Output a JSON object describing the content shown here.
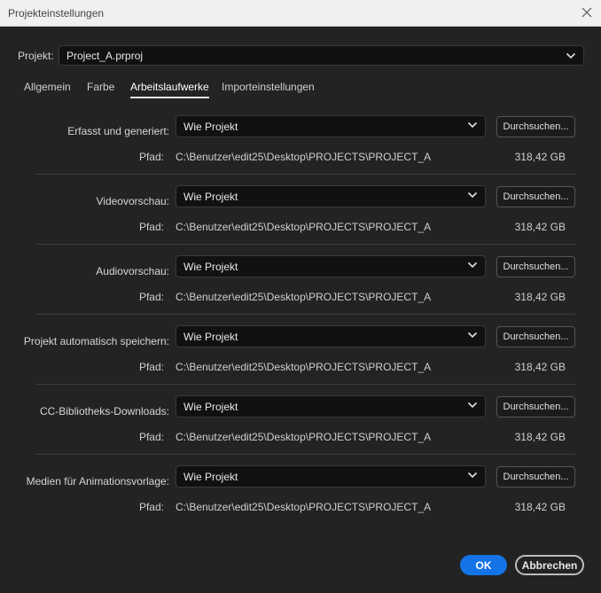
{
  "window": {
    "title": "Projekteinstellungen"
  },
  "project": {
    "label": "Projekt:",
    "value": "Project_A.prproj"
  },
  "tabs": [
    {
      "label": "Allgemein"
    },
    {
      "label": "Farbe"
    },
    {
      "label": "Arbeitslaufwerke",
      "active": true
    },
    {
      "label": "Importeinstellungen"
    }
  ],
  "sections": [
    {
      "label": "Erfasst und generiert:",
      "value": "Wie Projekt",
      "browse": "Durchsuchen...",
      "path_label": "Pfad:",
      "path": "C:\\Benutzer\\edit25\\Desktop\\PROJECTS\\PROJECT_A",
      "size": "318,42 GB"
    },
    {
      "label": "Videovorschau:",
      "value": "Wie Projekt",
      "browse": "Durchsuchen...",
      "path_label": "Pfad:",
      "path": "C:\\Benutzer\\edit25\\Desktop\\PROJECTS\\PROJECT_A",
      "size": "318,42 GB"
    },
    {
      "label": "Audiovorschau:",
      "value": "Wie Projekt",
      "browse": "Durchsuchen...",
      "path_label": "Pfad:",
      "path": "C:\\Benutzer\\edit25\\Desktop\\PROJECTS\\PROJECT_A",
      "size": "318,42 GB"
    },
    {
      "label": "Projekt automatisch speichern:",
      "value": "Wie Projekt",
      "browse": "Durchsuchen...",
      "path_label": "Pfad:",
      "path": "C:\\Benutzer\\edit25\\Desktop\\PROJECTS\\PROJECT_A",
      "size": "318,42 GB"
    },
    {
      "label": "CC-Bibliotheks-Downloads:",
      "value": "Wie Projekt",
      "browse": "Durchsuchen...",
      "path_label": "Pfad:",
      "path": "C:\\Benutzer\\edit25\\Desktop\\PROJECTS\\PROJECT_A",
      "size": "318,42 GB"
    },
    {
      "label": "Medien für Animationsvorlage:",
      "value": "Wie Projekt",
      "browse": "Durchsuchen...",
      "path_label": "Pfad:",
      "path": "C:\\Benutzer\\edit25\\Desktop\\PROJECTS\\PROJECT_A",
      "size": "318,42 GB"
    }
  ],
  "footer": {
    "ok_label": "OK",
    "cancel_label": "Abbrechen"
  },
  "colors": {
    "background": "#232323",
    "titlebar": "#f0f0f0",
    "accent": "#1473e6",
    "field": "#111111"
  },
  "icons": {
    "close": "close-icon",
    "dropdown": "chevron-down-icon"
  }
}
